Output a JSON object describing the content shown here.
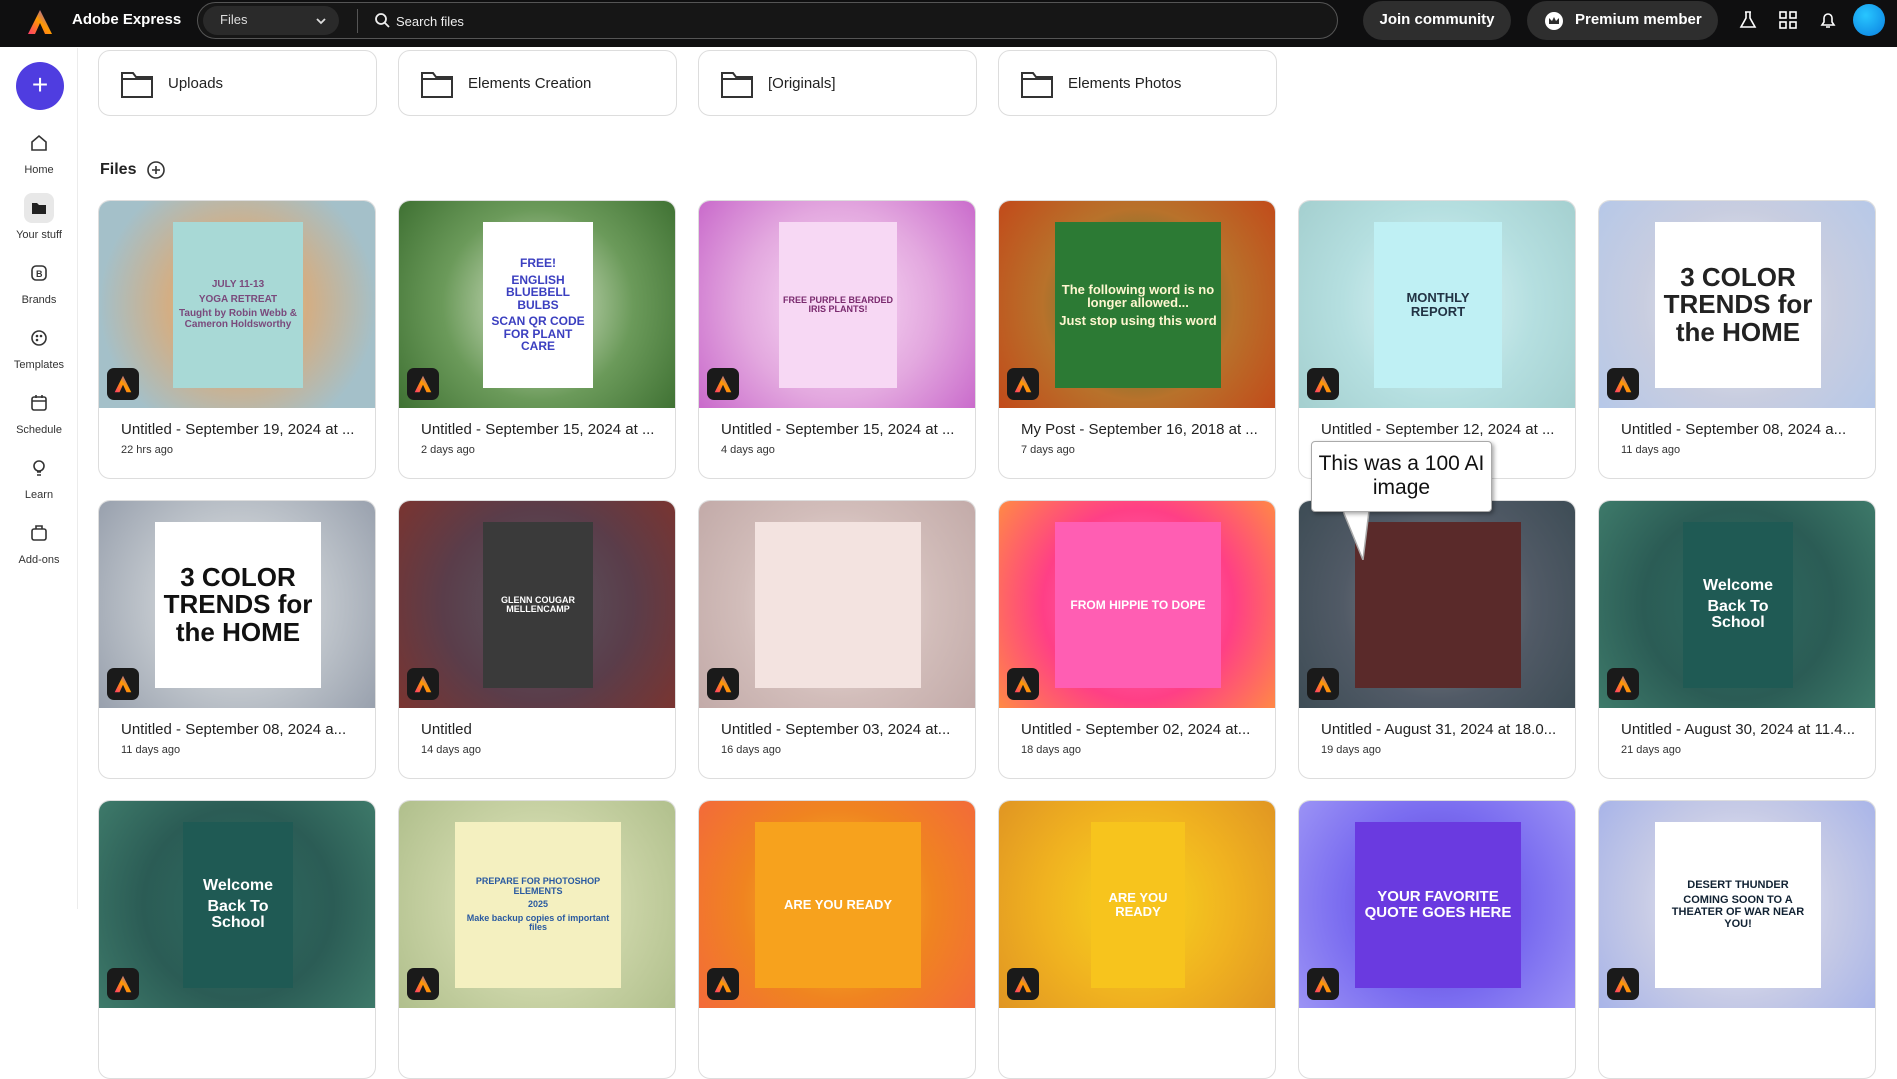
{
  "topbar": {
    "app_name": "Adobe Express",
    "scope_select": "Files",
    "search_placeholder": "Search files",
    "join_label": "Join community",
    "premium_label": "Premium member"
  },
  "sidebar": {
    "items": [
      {
        "label": "Home",
        "icon": "home-icon"
      },
      {
        "label": "Your stuff",
        "icon": "folder-icon"
      },
      {
        "label": "Brands",
        "icon": "brands-icon"
      },
      {
        "label": "Templates",
        "icon": "templates-icon"
      },
      {
        "label": "Schedule",
        "icon": "calendar-icon"
      },
      {
        "label": "Learn",
        "icon": "lightbulb-icon"
      },
      {
        "label": "Add-ons",
        "icon": "addons-icon"
      }
    ]
  },
  "folders": [
    {
      "label": "Uploads"
    },
    {
      "label": "Elements Creation"
    },
    {
      "label": "[Originals]"
    },
    {
      "label": "Elements Photos"
    }
  ],
  "files_heading": "Files",
  "cards": [
    {
      "title": "Untitled - September 19, 2024 at ...",
      "time": "22 hrs ago",
      "art": [
        "JULY 11-13",
        "YOGA RETREAT",
        "Taught by Robin Webb & Cameron Holdsworthy"
      ]
    },
    {
      "title": "Untitled - September 15, 2024 at ...",
      "time": "2 days ago",
      "art": [
        "FREE!",
        "ENGLISH BLUEBELL BULBS",
        "SCAN QR CODE FOR PLANT CARE"
      ]
    },
    {
      "title": "Untitled - September 15, 2024 at ...",
      "time": "4 days ago",
      "art": [
        "FREE PURPLE BEARDED IRIS PLANTS!"
      ]
    },
    {
      "title": "My Post - September 16, 2018 at ...",
      "time": "7 days ago",
      "art": [
        "The following word is no longer allowed...",
        "Just stop using this word"
      ]
    },
    {
      "title": "Untitled - September 12, 2024 at ...",
      "time": "",
      "art": [
        "MONTHLY REPORT"
      ]
    },
    {
      "title": "Untitled - September 08, 2024 a...",
      "time": "11 days ago",
      "art": [
        "3 COLOR TRENDS for the HOME"
      ]
    },
    {
      "title": "Untitled - September 08, 2024 a...",
      "time": "11 days ago",
      "art": [
        "3 COLOR TRENDS for the HOME"
      ]
    },
    {
      "title": "Untitled",
      "time": "14 days ago",
      "art": [
        "GLENN COUGAR MELLENCAMP"
      ]
    },
    {
      "title": "Untitled - September 03, 2024 at...",
      "time": "16 days ago",
      "art": []
    },
    {
      "title": "Untitled - September 02, 2024 at...",
      "time": "18 days ago",
      "art": [
        "FROM HIPPIE TO DOPE"
      ]
    },
    {
      "title": "Untitled - August 31, 2024 at 18.0...",
      "time": "19 days ago",
      "art": []
    },
    {
      "title": "Untitled - August 30, 2024 at 11.4...",
      "time": "21 days ago",
      "art": [
        "Welcome",
        "Back To School"
      ]
    },
    {
      "title": "",
      "time": "",
      "art": [
        "Welcome",
        "Back To School"
      ]
    },
    {
      "title": "",
      "time": "",
      "art": [
        "PREPARE FOR PHOTOSHOP ELEMENTS",
        "2025",
        "Make backup copies of important files"
      ]
    },
    {
      "title": "",
      "time": "",
      "art": [
        "ARE YOU READY"
      ]
    },
    {
      "title": "",
      "time": "",
      "art": [
        "ARE YOU READY"
      ]
    },
    {
      "title": "",
      "time": "",
      "art": [
        "YOUR FAVORITE QUOTE GOES HERE"
      ]
    },
    {
      "title": "",
      "time": "",
      "art": [
        "DESERT THUNDER",
        "COMING SOON TO A THEATER OF WAR NEAR YOU!"
      ]
    }
  ],
  "tooltip": {
    "text": "This was a 100 AI image"
  },
  "colors": {
    "topbar": "#0f0f10",
    "create_button": "#4f3de0",
    "avatar": "#1aa7f5"
  }
}
